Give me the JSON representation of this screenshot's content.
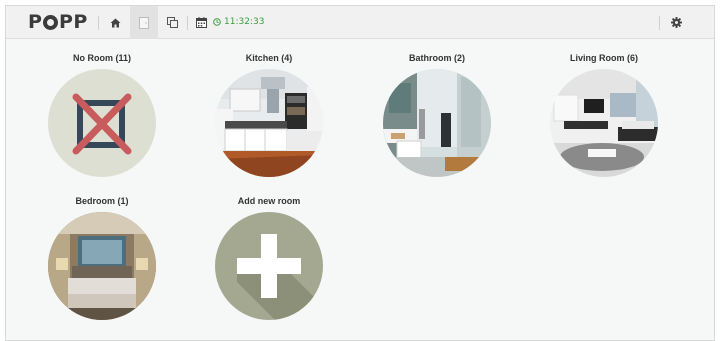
{
  "app": {
    "logo": "POPP"
  },
  "topbar": {
    "nav": [
      {
        "icon": "home-icon"
      },
      {
        "icon": "rooms-icon"
      },
      {
        "icon": "widgets-icon"
      },
      {
        "icon": "calendar-icon"
      }
    ],
    "clock_icon": "clock-icon",
    "time": "11:32:33",
    "settings_icon": "gear-icon"
  },
  "rooms": [
    {
      "title": "No Room (11)"
    },
    {
      "title": "Kitchen (4)"
    },
    {
      "title": "Bathroom (2)"
    },
    {
      "title": "Living Room (6)"
    },
    {
      "title": "Bedroom (1)"
    },
    {
      "title": "Add new room"
    }
  ]
}
